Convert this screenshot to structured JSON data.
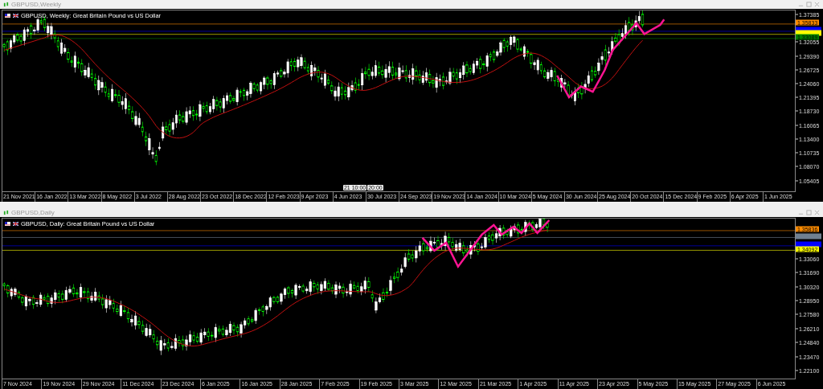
{
  "windows": [
    {
      "title": "GBPUSD,Weekly",
      "header": "GBPUSD, Weekly:  Great Britain Pound vs US Dollar",
      "price_ticks": [
        "1.37385",
        "1.32055",
        "1.29390",
        "1.26725",
        "1.24060",
        "1.21395",
        "1.18730",
        "1.16065",
        "1.13400",
        "1.10735",
        "1.08070",
        "1.05405"
      ],
      "price_lines": [
        {
          "color": "#ff8c00",
          "label": "1.35833"
        },
        {
          "color": "#0000ff"
        },
        {
          "color": "#ffff00"
        },
        {
          "color": "#008000",
          "label": "1.33089"
        }
      ],
      "date_ticks": [
        "21 Nov 2021",
        "16 Jan 2022",
        "13 Mar 2022",
        "8 May 2022",
        "3 Jul 2022",
        "28 Aug 2022",
        "23 Oct 2022",
        "18 Dec 2022",
        "12 Feb 2023",
        "9 Apr 2023",
        "4 Jun 2023",
        "30 Jul 2023",
        "24 Sep 2023",
        "19 Nov 2023",
        "14 Jan 2024",
        "10 Mar 2024",
        "5 May 2024",
        "30 Jun 2024",
        "25 Aug 2024",
        "20 Oct 2024",
        "15 Dec 2024",
        "9 Feb 2025",
        "6 Apr 2025",
        "1 Jun 2025"
      ],
      "crosshair_tags": [
        "21 10:00",
        "20:00"
      ]
    },
    {
      "title": "GBPUSD,Daily",
      "header": "GBPUSD, Daily:  Great Britain Pound vs US Dollar",
      "price_ticks": [
        "1.33060",
        "1.31690",
        "1.30320",
        "1.28950",
        "1.27580",
        "1.26210",
        "1.24840",
        "1.23470",
        "1.22100"
      ],
      "price_lines": [
        {
          "color": "#ff8c00",
          "label": "1.35836"
        },
        {
          "color": "#708090"
        },
        {
          "color": "#0000ff"
        },
        {
          "color": "#ffff00",
          "label": "1.34092"
        }
      ],
      "date_ticks": [
        "7 Nov 2024",
        "19 Nov 2024",
        "29 Nov 2024",
        "11 Dec 2024",
        "23 Dec 2024",
        "6 Jan 2025",
        "16 Jan 2025",
        "28 Jan 2025",
        "7 Feb 2025",
        "19 Feb 2025",
        "3 Mar 2025",
        "12 Mar 2025",
        "21 Mar 2025",
        "1 Apr 2025",
        "11 Apr 2025",
        "23 Apr 2025",
        "5 May 2025",
        "15 May 2025",
        "27 May 2025",
        "6 Jun 2025"
      ]
    }
  ]
}
